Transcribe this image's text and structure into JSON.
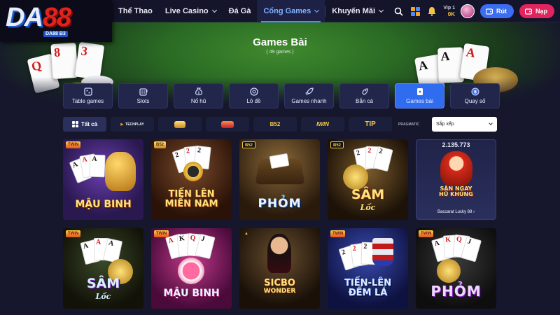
{
  "brand": {
    "logo_main": "DA",
    "logo_num": "88",
    "logo_sub": "DA88 B3"
  },
  "nav": {
    "items": [
      {
        "label": "Thể Thao",
        "chevron": false
      },
      {
        "label": "Live Casino",
        "chevron": true
      },
      {
        "label": "Đá Gà",
        "chevron": false
      },
      {
        "label": "Cổng Games",
        "chevron": true,
        "active": true
      },
      {
        "label": "Khuyến Mãi",
        "chevron": true
      }
    ]
  },
  "account": {
    "vip_label": "Vip 1",
    "balance": "0K",
    "withdraw_label": "Rút",
    "deposit_label": "Nạp"
  },
  "hero": {
    "title": "Games Bài",
    "count": "( 49 games )"
  },
  "categories": [
    {
      "label": "Table games",
      "icon": "table-icon"
    },
    {
      "label": "Slots",
      "icon": "slot-machine-icon"
    },
    {
      "label": "Nổ hũ",
      "icon": "money-bag-icon"
    },
    {
      "label": "Lô đề",
      "icon": "lottery-ball-icon"
    },
    {
      "label": "Games nhanh",
      "icon": "rocket-icon"
    },
    {
      "label": "Bắn cá",
      "icon": "fish-icon"
    },
    {
      "label": "Games bài",
      "icon": "card-icon",
      "active": true
    },
    {
      "label": "Quay số",
      "icon": "number-ball-icon"
    }
  ],
  "filters": {
    "all_label": "Tất cả",
    "providers": [
      "TECHPLAY",
      "",
      "",
      "B52",
      "IWIN",
      "TIP",
      "PRAGMATIC"
    ],
    "sort_label": "Sắp xếp"
  },
  "games": [
    {
      "title": "MẬU BINH",
      "badge": "",
      "style": "maubinh"
    },
    {
      "title_line1": "TIẾN LÊN",
      "title_line2": "MIỀN NAM",
      "badge": "",
      "style": "tienlen"
    },
    {
      "title": "PHỎM",
      "badge": "B52",
      "style": "phom1"
    },
    {
      "title": "SÂM",
      "subtitle": "Lốc",
      "badge": "B52",
      "style": "sam1"
    },
    {
      "jackpot": "2.135.773",
      "title_line1": "SĂN NGAY",
      "title_line2": "HŨ KHỦNG",
      "caption": "Baccarat Lucky 88",
      "style": "baccarat"
    },
    {
      "title": "SÂM",
      "subtitle": "Lốc",
      "badge": "",
      "style": "sam2"
    },
    {
      "title": "MẬU BINH",
      "badge": "",
      "style": "maubinh2"
    },
    {
      "title_line1": "SICBO",
      "title_line2": "WONDER",
      "badge": "",
      "style": "sicbo"
    },
    {
      "title_line1": "TIẾN-LÊN",
      "title_line2": "ĐẾM LÁ",
      "badge": "",
      "style": "tiendem"
    },
    {
      "title": "PHỎM",
      "badge": "",
      "style": "phom2"
    }
  ],
  "colors": {
    "accent": "#2f6cf0",
    "deposit": "#e2245e",
    "withdraw": "#3b6df2",
    "bg": "#16162c"
  }
}
